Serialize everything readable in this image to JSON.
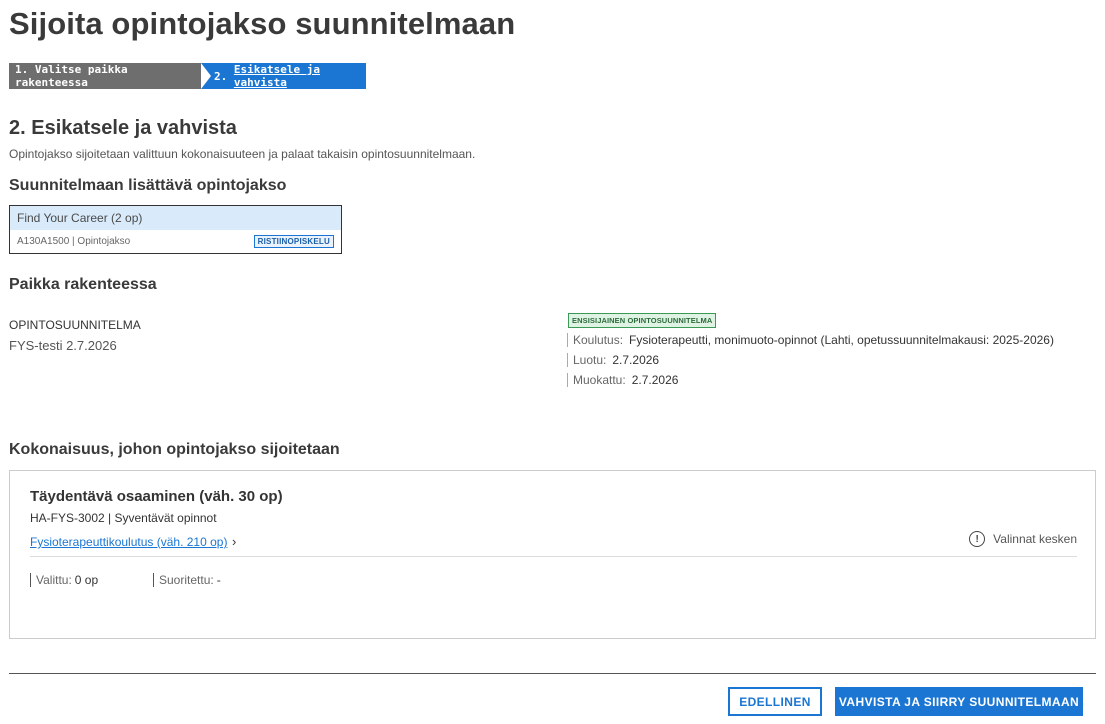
{
  "page": {
    "title": "Sijoita opintojakso suunnitelmaan"
  },
  "stepper": {
    "steps": [
      {
        "label": "1. Valitse paikka rakenteessa",
        "active": false
      },
      {
        "number": "2.",
        "label": "Esikatsele ja vahvista",
        "active": true
      }
    ]
  },
  "section": {
    "heading": "2. Esikatsele ja vahvista",
    "description": "Opintojakso sijoitetaan valittuun kokonaisuuteen ja palaat takaisin opintosuunnitelmaan."
  },
  "course": {
    "heading": "Suunnitelmaan lisättävä opintojakso",
    "title": "Find Your Career (2 op)",
    "meta": "A130A1500 | Opintojakso",
    "badge": "RISTIINOPISKELU"
  },
  "placement": {
    "heading": "Paikka rakenteessa",
    "plan_label": "OPINTOSUUNNITELMA",
    "plan_name": "FYS-testi 2.7.2026",
    "primary_badge": "ENSISIJAINEN OPINTOSUUNNITELMA",
    "details": [
      {
        "key": "Koulutus:",
        "value": "Fysioterapeutti, monimuoto-opinnot (Lahti, opetussuunnitelmakausi: 2025-2026)"
      },
      {
        "key": "Luotu:",
        "value": "2.7.2026"
      },
      {
        "key": "Muokattu:",
        "value": "2.7.2026"
      }
    ]
  },
  "kokonaisuus": {
    "heading": "Kokonaisuus, johon opintojakso sijoitetaan",
    "title": "Täydentävä osaaminen (väh. 30 op)",
    "code": "HA-FYS-3002 | Syventävät opinnot",
    "parent_link": "Fysioterapeuttikoulutus (väh. 210 op)",
    "status": "Valinnat kesken",
    "selected_key": "Valittu:",
    "selected_value": "0 op",
    "completed_key": "Suoritettu:",
    "completed_value": "-"
  },
  "actions": {
    "previous": "EDELLINEN",
    "confirm": "VAHVISTA JA SIIRRY SUUNNITELMAAN"
  },
  "colors": {
    "primary": "#1b76d3",
    "step_inactive": "#6e6e6e",
    "badge_green": "#3a9a55"
  },
  "icons": {
    "status": "info-circle-icon",
    "link": "chevron-right-icon"
  }
}
